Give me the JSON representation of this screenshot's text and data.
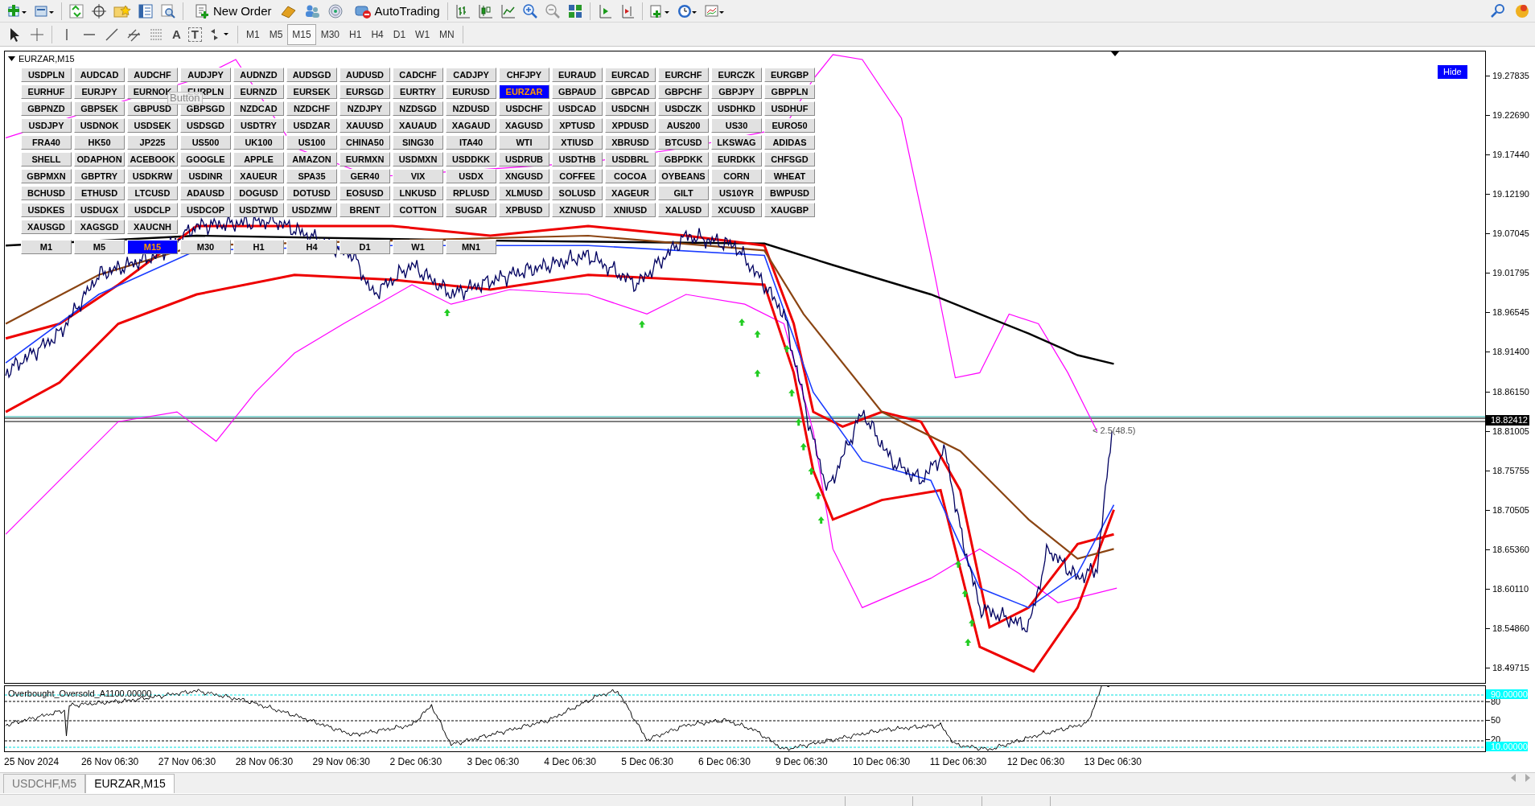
{
  "toolbar": {
    "new_order": "New Order",
    "autotrading": "AutoTrading"
  },
  "drawing_tools": {
    "text_tool": "A",
    "label_tool": "T"
  },
  "timeframes": [
    {
      "label": "M1",
      "selected": false
    },
    {
      "label": "M5",
      "selected": false
    },
    {
      "label": "M15",
      "selected": true
    },
    {
      "label": "M30",
      "selected": false
    },
    {
      "label": "H1",
      "selected": false
    },
    {
      "label": "H4",
      "selected": false
    },
    {
      "label": "D1",
      "selected": false
    },
    {
      "label": "W1",
      "selected": false
    },
    {
      "label": "MN",
      "selected": false
    }
  ],
  "chart": {
    "title": "EURZAR,M15",
    "hide_button": "Hide",
    "tooltip": "Button",
    "annotation": "< 2.5(48.5)",
    "current_price": "18.82412",
    "price_labels": [
      "19.27835",
      "19.22690",
      "19.17440",
      "19.12190",
      "19.07045",
      "19.01795",
      "18.96545",
      "18.91400",
      "18.86150",
      "18.81005",
      "18.75755",
      "18.70505",
      "18.65360",
      "18.60110",
      "18.54860",
      "18.49715"
    ],
    "symbol_buttons": [
      {
        "label": "USDPLN",
        "selected": false
      },
      {
        "label": "AUDCAD",
        "selected": false
      },
      {
        "label": "AUDCHF",
        "selected": false
      },
      {
        "label": "AUDJPY",
        "selected": false
      },
      {
        "label": "AUDNZD",
        "selected": false
      },
      {
        "label": "AUDSGD",
        "selected": false
      },
      {
        "label": "AUDUSD",
        "selected": false
      },
      {
        "label": "CADCHF",
        "selected": false
      },
      {
        "label": "CADJPY",
        "selected": false
      },
      {
        "label": "CHFJPY",
        "selected": false
      },
      {
        "label": "EURAUD",
        "selected": false
      },
      {
        "label": "EURCAD",
        "selected": false
      },
      {
        "label": "EURCHF",
        "selected": false
      },
      {
        "label": "EURCZK",
        "selected": false
      },
      {
        "label": "EURGBP",
        "selected": false
      },
      {
        "label": "EURHUF",
        "selected": false
      },
      {
        "label": "EURJPY",
        "selected": false
      },
      {
        "label": "EURNOK",
        "selected": false
      },
      {
        "label": "EURPLN",
        "selected": false
      },
      {
        "label": "EURNZD",
        "selected": false
      },
      {
        "label": "EURSEK",
        "selected": false
      },
      {
        "label": "EURSGD",
        "selected": false
      },
      {
        "label": "EURTRY",
        "selected": false
      },
      {
        "label": "EURUSD",
        "selected": false
      },
      {
        "label": "EURZAR",
        "selected": true
      },
      {
        "label": "GBPAUD",
        "selected": false
      },
      {
        "label": "GBPCAD",
        "selected": false
      },
      {
        "label": "GBPCHF",
        "selected": false
      },
      {
        "label": "GBPJPY",
        "selected": false
      },
      {
        "label": "GBPPLN",
        "selected": false
      },
      {
        "label": "GBPNZD",
        "selected": false
      },
      {
        "label": "GBPSEK",
        "selected": false
      },
      {
        "label": "GBPUSD",
        "selected": false
      },
      {
        "label": "GBPSGD",
        "selected": false
      },
      {
        "label": "NZDCAD",
        "selected": false
      },
      {
        "label": "NZDCHF",
        "selected": false
      },
      {
        "label": "NZDJPY",
        "selected": false
      },
      {
        "label": "NZDSGD",
        "selected": false
      },
      {
        "label": "NZDUSD",
        "selected": false
      },
      {
        "label": "USDCHF",
        "selected": false
      },
      {
        "label": "USDCAD",
        "selected": false
      },
      {
        "label": "USDCNH",
        "selected": false
      },
      {
        "label": "USDCZK",
        "selected": false
      },
      {
        "label": "USDHKD",
        "selected": false
      },
      {
        "label": "USDHUF",
        "selected": false
      },
      {
        "label": "USDJPY",
        "selected": false
      },
      {
        "label": "USDNOK",
        "selected": false
      },
      {
        "label": "USDSEK",
        "selected": false
      },
      {
        "label": "USDSGD",
        "selected": false
      },
      {
        "label": "USDTRY",
        "selected": false
      },
      {
        "label": "USDZAR",
        "selected": false
      },
      {
        "label": "XAUUSD",
        "selected": false
      },
      {
        "label": "XAUAUD",
        "selected": false
      },
      {
        "label": "XAGAUD",
        "selected": false
      },
      {
        "label": "XAGUSD",
        "selected": false
      },
      {
        "label": "XPTUSD",
        "selected": false
      },
      {
        "label": "XPDUSD",
        "selected": false
      },
      {
        "label": "AUS200",
        "selected": false
      },
      {
        "label": "US30",
        "selected": false
      },
      {
        "label": "EURO50",
        "selected": false
      },
      {
        "label": "FRA40",
        "selected": false
      },
      {
        "label": "HK50",
        "selected": false
      },
      {
        "label": "JP225",
        "selected": false
      },
      {
        "label": "US500",
        "selected": false
      },
      {
        "label": "UK100",
        "selected": false
      },
      {
        "label": "US100",
        "selected": false
      },
      {
        "label": "CHINA50",
        "selected": false
      },
      {
        "label": "SING30",
        "selected": false
      },
      {
        "label": "ITA40",
        "selected": false
      },
      {
        "label": "WTI",
        "selected": false
      },
      {
        "label": "XTIUSD",
        "selected": false
      },
      {
        "label": "XBRUSD",
        "selected": false
      },
      {
        "label": "BTCUSD",
        "selected": false
      },
      {
        "label": "LKSWAG",
        "selected": false
      },
      {
        "label": "ADIDAS",
        "selected": false
      },
      {
        "label": "SHELL",
        "selected": false
      },
      {
        "label": "ODAPHON",
        "selected": false
      },
      {
        "label": "ACEBOOK",
        "selected": false
      },
      {
        "label": "GOOGLE",
        "selected": false
      },
      {
        "label": "APPLE",
        "selected": false
      },
      {
        "label": "AMAZON",
        "selected": false
      },
      {
        "label": "EURMXN",
        "selected": false
      },
      {
        "label": "USDMXN",
        "selected": false
      },
      {
        "label": "USDDKK",
        "selected": false
      },
      {
        "label": "USDRUB",
        "selected": false
      },
      {
        "label": "USDTHB",
        "selected": false
      },
      {
        "label": "USDBRL",
        "selected": false
      },
      {
        "label": "GBPDKK",
        "selected": false
      },
      {
        "label": "EURDKK",
        "selected": false
      },
      {
        "label": "CHFSGD",
        "selected": false
      },
      {
        "label": "GBPMXN",
        "selected": false
      },
      {
        "label": "GBPTRY",
        "selected": false
      },
      {
        "label": "USDKRW",
        "selected": false
      },
      {
        "label": "USDINR",
        "selected": false
      },
      {
        "label": "XAUEUR",
        "selected": false
      },
      {
        "label": "SPA35",
        "selected": false
      },
      {
        "label": "GER40",
        "selected": false
      },
      {
        "label": "VIX",
        "selected": false
      },
      {
        "label": "USDX",
        "selected": false
      },
      {
        "label": "XNGUSD",
        "selected": false
      },
      {
        "label": "COFFEE",
        "selected": false
      },
      {
        "label": "COCOA",
        "selected": false
      },
      {
        "label": "OYBEANS",
        "selected": false
      },
      {
        "label": "CORN",
        "selected": false
      },
      {
        "label": "WHEAT",
        "selected": false
      },
      {
        "label": "BCHUSD",
        "selected": false
      },
      {
        "label": "ETHUSD",
        "selected": false
      },
      {
        "label": "LTCUSD",
        "selected": false
      },
      {
        "label": "ADAUSD",
        "selected": false
      },
      {
        "label": "DOGUSD",
        "selected": false
      },
      {
        "label": "DOTUSD",
        "selected": false
      },
      {
        "label": "EOSUSD",
        "selected": false
      },
      {
        "label": "LNKUSD",
        "selected": false
      },
      {
        "label": "RPLUSD",
        "selected": false
      },
      {
        "label": "XLMUSD",
        "selected": false
      },
      {
        "label": "SOLUSD",
        "selected": false
      },
      {
        "label": "XAGEUR",
        "selected": false
      },
      {
        "label": "GILT",
        "selected": false
      },
      {
        "label": "US10YR",
        "selected": false
      },
      {
        "label": "BWPUSD",
        "selected": false
      },
      {
        "label": "USDKES",
        "selected": false
      },
      {
        "label": "USDUGX",
        "selected": false
      },
      {
        "label": "USDCLP",
        "selected": false
      },
      {
        "label": "USDCOP",
        "selected": false
      },
      {
        "label": "USDTWD",
        "selected": false
      },
      {
        "label": "USDZMW",
        "selected": false
      },
      {
        "label": "BRENT",
        "selected": false
      },
      {
        "label": "COTTON",
        "selected": false
      },
      {
        "label": "SUGAR",
        "selected": false
      },
      {
        "label": "XPBUSD",
        "selected": false
      },
      {
        "label": "XZNUSD",
        "selected": false
      },
      {
        "label": "XNIUSD",
        "selected": false
      },
      {
        "label": "XALUSD",
        "selected": false
      },
      {
        "label": "XCUUSD",
        "selected": false
      },
      {
        "label": "XAUGBP",
        "selected": false
      },
      {
        "label": "XAUSGD",
        "selected": false
      },
      {
        "label": "XAGSGD",
        "selected": false
      },
      {
        "label": "XAUCNH",
        "selected": false
      }
    ],
    "timeframe_buttons": [
      {
        "label": "M1",
        "selected": false
      },
      {
        "label": "M5",
        "selected": false
      },
      {
        "label": "M15",
        "selected": true
      },
      {
        "label": "M30",
        "selected": false
      },
      {
        "label": "H1",
        "selected": false
      },
      {
        "label": "H4",
        "selected": false
      },
      {
        "label": "D1",
        "selected": false
      },
      {
        "label": "W1",
        "selected": false
      },
      {
        "label": "MN1",
        "selected": false
      }
    ]
  },
  "oscillator": {
    "title": "Overbought_Oversold_A1100.00000",
    "labels": [
      {
        "text": "90.00000",
        "highlighted": true
      },
      {
        "text": "80",
        "highlighted": false
      },
      {
        "text": "50",
        "highlighted": false
      },
      {
        "text": "20",
        "highlighted": false
      },
      {
        "text": "10.00000",
        "highlighted": true
      }
    ]
  },
  "time_labels": [
    "25 Nov 2024",
    "26 Nov 06:30",
    "27 Nov 06:30",
    "28 Nov 06:30",
    "29 Nov 06:30",
    "2 Dec 06:30",
    "3 Dec 06:30",
    "4 Dec 06:30",
    "5 Dec 06:30",
    "6 Dec 06:30",
    "9 Dec 06:30",
    "10 Dec 06:30",
    "11 Dec 06:30",
    "12 Dec 06:30",
    "13 Dec 06:30"
  ],
  "tabs": [
    {
      "label": "USDCHF,M5",
      "selected": false
    },
    {
      "label": "EURZAR,M15",
      "selected": true
    }
  ]
}
